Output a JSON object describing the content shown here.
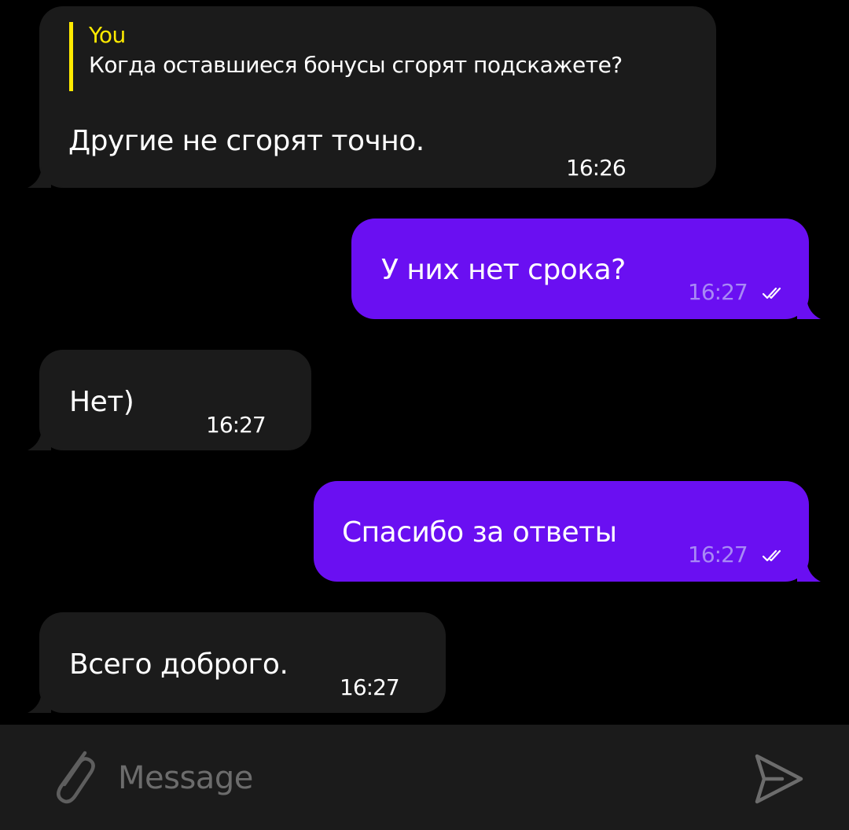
{
  "messages": [
    {
      "direction": "incoming",
      "reply": {
        "author": "You",
        "text": "Когда оставшиеся бонусы сгорят подскажете?"
      },
      "text": "Другие не сгорят точно.",
      "time": "16:26"
    },
    {
      "direction": "outgoing",
      "text": "У них нет срока?",
      "time": "16:27",
      "status": "read"
    },
    {
      "direction": "incoming",
      "text": "Нет)",
      "time": "16:27"
    },
    {
      "direction": "outgoing",
      "text": "Спасибо за ответы",
      "time": "16:27",
      "status": "read"
    },
    {
      "direction": "incoming",
      "text": "Всего доброго.",
      "time": "16:27"
    }
  ],
  "composer": {
    "placeholder": "Message",
    "value": "",
    "attach_icon": "paperclip-icon",
    "send_icon": "send-icon"
  },
  "colors": {
    "background": "#000000",
    "incoming_bubble": "#1b1b1b",
    "outgoing_bubble": "#6a0ff2",
    "reply_accent": "#ffea00",
    "outgoing_time": "#a889f5",
    "composer_bg": "#1b1b1b",
    "placeholder": "#6c6c6c"
  }
}
